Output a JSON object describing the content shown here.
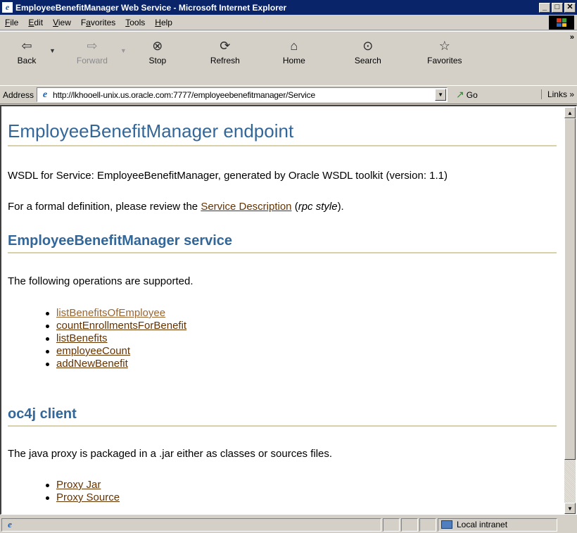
{
  "window": {
    "title": "EmployeeBenefitManager Web Service - Microsoft Internet Explorer",
    "min_glyph": "_",
    "max_glyph": "□",
    "close_glyph": "✕"
  },
  "menu": {
    "items": [
      "File",
      "Edit",
      "View",
      "Favorites",
      "Tools",
      "Help"
    ],
    "underlines": [
      "F",
      "E",
      "V",
      "a",
      "T",
      "H"
    ]
  },
  "toolbar": {
    "back": "Back",
    "forward": "Forward",
    "stop": "Stop",
    "refresh": "Refresh",
    "home": "Home",
    "search": "Search",
    "favorites": "Favorites",
    "more": "»"
  },
  "address": {
    "label": "Address",
    "url": "http://lkhooell-unix.us.oracle.com:7777/employeebenefitmanager/Service",
    "go": "Go",
    "links": "Links »"
  },
  "page": {
    "h1": "EmployeeBenefitManager endpoint",
    "wsdl_line": "WSDL for Service: EmployeeBenefitManager, generated by Oracle WSDL toolkit (version: 1.1)",
    "review_prefix": "For a formal definition, please review the ",
    "review_link": "Service Description",
    "review_mid": " (",
    "review_style": "rpc style",
    "review_suffix": ").",
    "service_heading": "EmployeeBenefitManager service",
    "ops_intro": "The following operations are supported.",
    "operations": [
      "listBenefitsOfEmployee",
      "countEnrollmentsForBenefit",
      "listBenefits",
      "employeeCount",
      "addNewBenefit"
    ],
    "client_heading": "oc4j client",
    "client_intro": "The java proxy is packaged in a .jar either as classes or sources files.",
    "client_links": [
      "Proxy Jar",
      "Proxy Source"
    ]
  },
  "status": {
    "zone": "Local intranet"
  }
}
